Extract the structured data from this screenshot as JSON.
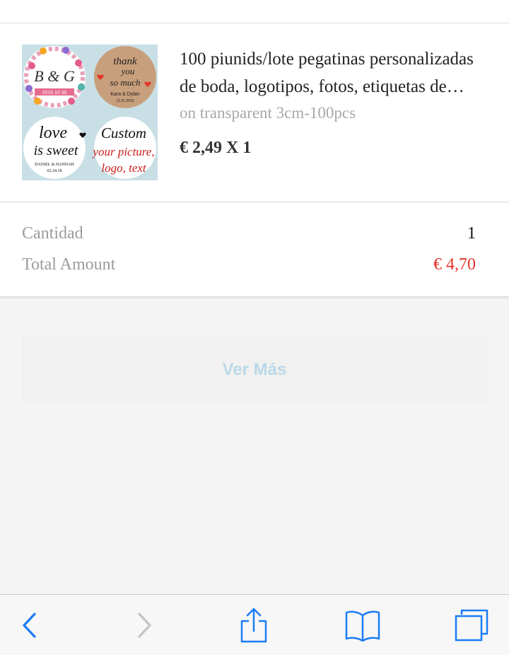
{
  "product": {
    "title_line1": "100 piunids/lote pegatinas personalizadas",
    "title_line2": "de boda, logotipos, fotos, etiquetas de…",
    "variant": "on transparent 3cm-100pcs",
    "price": "€ 2,49 X 1",
    "thumbnail": {
      "sticker1_initials": "B & G",
      "sticker1_banner": "2015 10 30",
      "sticker2_line1": "thank",
      "sticker2_line2": "you",
      "sticker2_line3": "so much",
      "sticker2_names": "Kara & Dylan",
      "sticker2_date": "12.31.2016",
      "sticker3_line1": "love",
      "sticker3_line2": "is sweet",
      "sticker3_names": "DANIEL & HANNAH",
      "sticker3_date": "02.24.18",
      "sticker4_line1": "Custom",
      "sticker4_line2": "your picture,",
      "sticker4_line3": "logo, text"
    }
  },
  "summary": {
    "quantity_label": "Cantidad",
    "quantity_value": "1",
    "total_label": "Total Amount",
    "total_value": "€ 4,70"
  },
  "ver_mas_label": "Ver Más",
  "colors": {
    "accent_red": "#e5332a",
    "ios_blue": "#1a7cf5",
    "ver_mas_text": "#b9d9e8"
  },
  "toolbar": {
    "back_icon": "chevron-left-icon",
    "forward_icon": "chevron-right-icon",
    "share_icon": "share-icon",
    "bookmarks_icon": "bookmarks-icon",
    "tabs_icon": "tabs-icon"
  }
}
